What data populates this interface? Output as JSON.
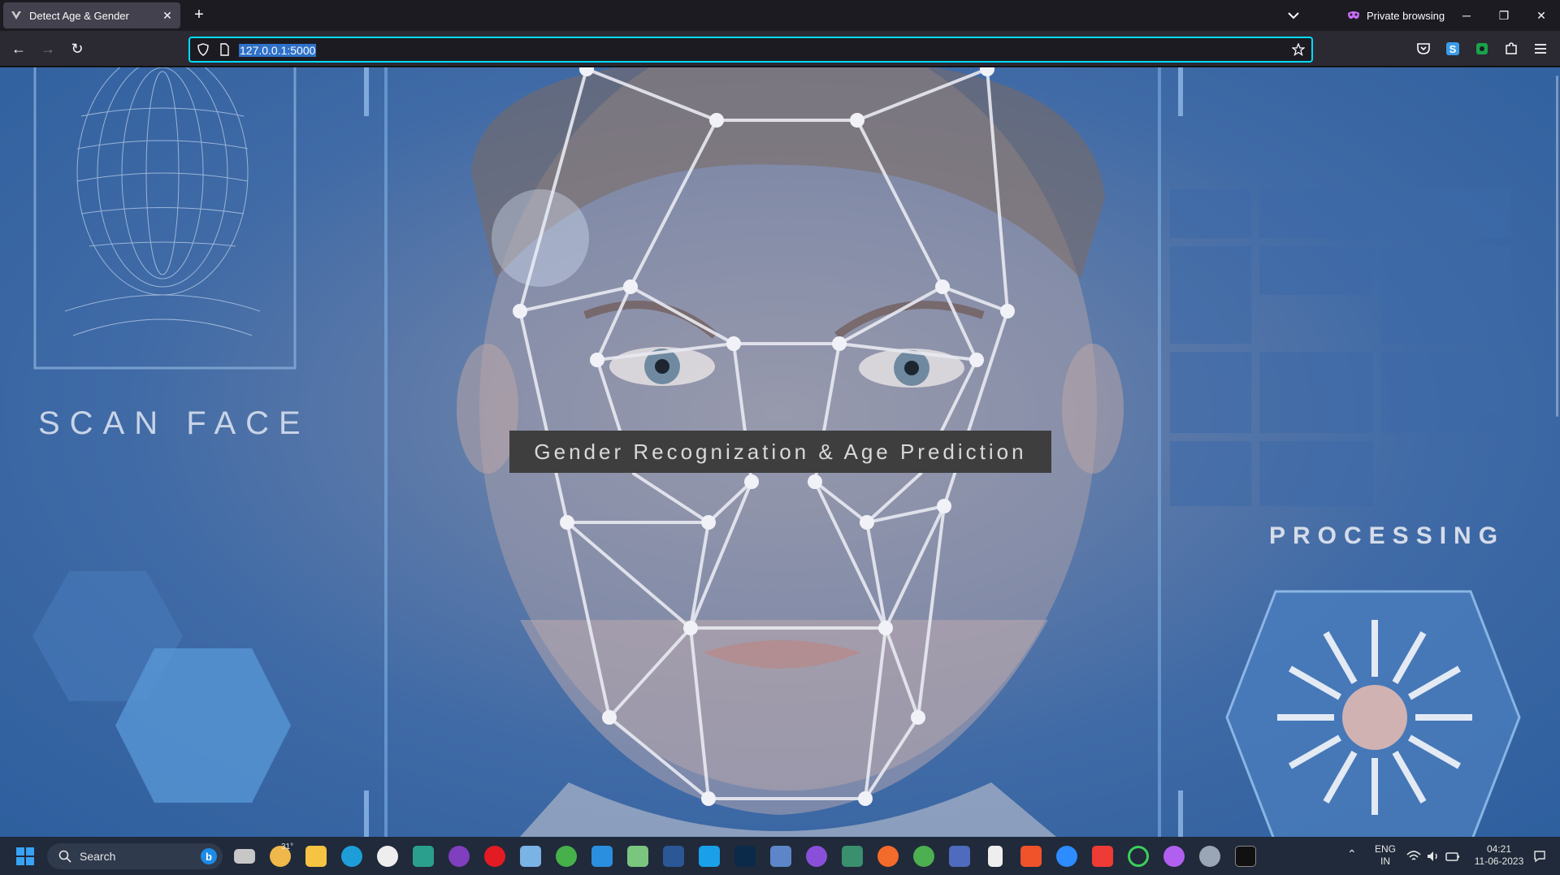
{
  "browser": {
    "tab_title": "Detect Age & Gender",
    "private_label": "Private browsing",
    "url": "127.0.0.1:5000"
  },
  "page": {
    "left_label": "SCAN FACE",
    "right_label": "PROCESSING",
    "headline": "Gender Recognization & Age Prediction"
  },
  "taskbar": {
    "search_placeholder": "Search",
    "weather": "31°",
    "lang_top": "ENG",
    "lang_bottom": "IN",
    "time": "04:21",
    "date": "11-06-2023",
    "apps": [
      "task-view",
      "weather",
      "file-explorer",
      "edge",
      "teamviewer",
      "installer",
      "tor",
      "opera",
      "3d-box",
      "green-app",
      "vscode",
      "notepad",
      "word",
      "todesk",
      "photoshop",
      "network",
      "github",
      "settings-grid",
      "firefox",
      "chrome",
      "teams",
      "file",
      "brave",
      "zoom",
      "anydesk",
      "green-ring",
      "firefox-private",
      "gear",
      "terminal"
    ]
  },
  "colors": {
    "accent_url_border": "#00ddff",
    "headline_bg": "#3e3e3e",
    "page_bg": "#3f6aa6"
  }
}
